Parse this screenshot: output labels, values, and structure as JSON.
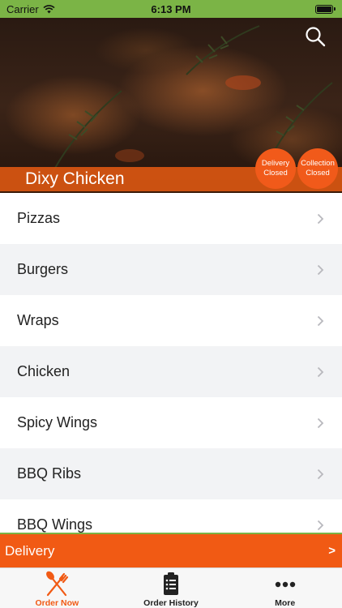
{
  "status_bar": {
    "carrier": "Carrier",
    "time": "6:13 PM"
  },
  "header": {
    "restaurant_name": "Dixy Chicken",
    "search_icon": "search-icon",
    "delivery_badge": {
      "line1": "Delivery",
      "line2": "Closed"
    },
    "collection_badge": {
      "line1": "Collection",
      "line2": "Closed"
    }
  },
  "menu": {
    "categories": [
      {
        "label": "Pizzas"
      },
      {
        "label": "Burgers"
      },
      {
        "label": "Wraps"
      },
      {
        "label": "Chicken"
      },
      {
        "label": "Spicy Wings"
      },
      {
        "label": "BBQ Ribs"
      },
      {
        "label": "BBQ Wings"
      }
    ]
  },
  "delivery_bar": {
    "label": "Delivery",
    "arrow": ">"
  },
  "tab_bar": {
    "tabs": [
      {
        "label": "Order Now",
        "icon": "fork-knife-icon",
        "active": true
      },
      {
        "label": "Order History",
        "icon": "clipboard-list-icon",
        "active": false
      },
      {
        "label": "More",
        "icon": "more-dots-icon",
        "active": false
      }
    ]
  },
  "colors": {
    "accent_orange": "#f15a14",
    "status_green": "#7bb446"
  }
}
